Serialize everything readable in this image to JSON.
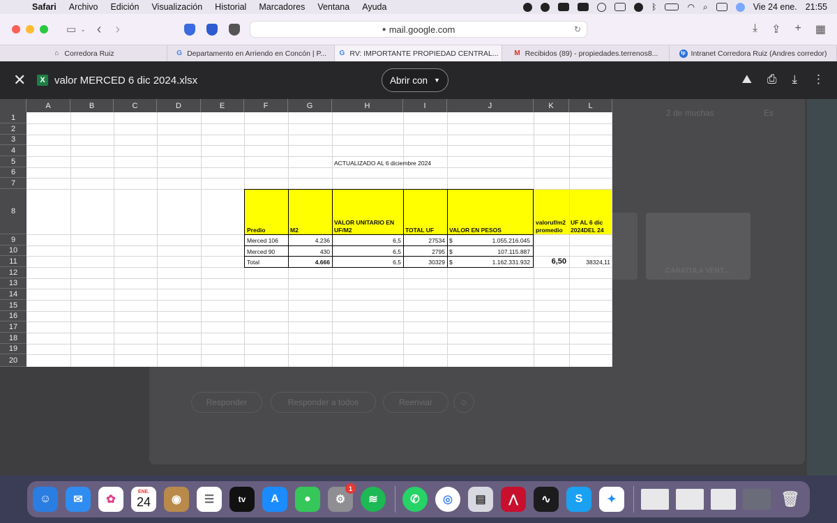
{
  "menubar": {
    "app": "Safari",
    "items": [
      "Archivo",
      "Edición",
      "Visualización",
      "Historial",
      "Marcadores",
      "Ventana",
      "Ayuda"
    ],
    "date": "Vie 24 ene.",
    "time": "21:55"
  },
  "browser": {
    "url": "mail.google.com",
    "tabs": [
      {
        "label": "Corredora Ruiz",
        "icon": "house-icon"
      },
      {
        "label": "Departamento en Arriendo en Concón | P...",
        "icon": "google-icon"
      },
      {
        "label": "RV: IMPORTANTE PROPIEDAD CENTRAL...",
        "icon": "google-icon"
      },
      {
        "label": "Recibidos (89) - propiedades.terrenos8...",
        "icon": "gmail-icon"
      },
      {
        "label": "Intranet Corredora Ruiz (Andres corredor)",
        "icon": "intranet-icon"
      }
    ]
  },
  "viewer": {
    "file_name": "valor MERCED 6 dic 2024.xlsx",
    "open_with": "Abrir con"
  },
  "background": {
    "page_count": "2 de muchas",
    "lang": "Es",
    "reply": "Responder",
    "reply_all": "Responder a todos",
    "forward": "Reenviar",
    "attachment": "CARATULA VENT..."
  },
  "sheet": {
    "columns": [
      "A",
      "B",
      "C",
      "D",
      "E",
      "F",
      "G",
      "H",
      "I",
      "J",
      "K",
      "L"
    ],
    "rows": [
      "1",
      "2",
      "3",
      "4",
      "5",
      "6",
      "7",
      "8",
      "9",
      "10",
      "11",
      "12",
      "13",
      "14",
      "15",
      "16",
      "17",
      "18",
      "19",
      "20"
    ],
    "title": "ACTUALIZADO AL 6 diciembre 2024",
    "headers": {
      "predio": "Predio",
      "m2": "M2",
      "valor_unitario_1": "VALOR UNITARIO EN",
      "valor_unitario_2": "UF/M2",
      "total_uf": "TOTAL UF",
      "valor_pesos": "VALOR EN PESOS",
      "valoruf_1": "valoruf/m2",
      "valoruf_2": "promedio",
      "uf_al_1": "UF AL 6 dic",
      "uf_al_2": "2024DEL 24"
    },
    "data_rows": [
      {
        "predio": "Merced 106",
        "m2": "4.236",
        "unit": "6,5",
        "total_uf": "27534",
        "currency": "$",
        "pesos": "1.055.216.045"
      },
      {
        "predio": "Merced 90",
        "m2": "430",
        "unit": "6,5",
        "total_uf": "2795",
        "currency": "$",
        "pesos": "107.115.887"
      },
      {
        "predio": "Total",
        "m2": "4.666",
        "unit": "6,5",
        "total_uf": "30329",
        "currency": "$",
        "pesos": "1.162.331.932",
        "avg": "6,50",
        "uf": "38324,11"
      }
    ]
  },
  "dock": {
    "calendar_month": "ENE.",
    "calendar_day": "24",
    "settings_badge": "1",
    "tv_label": "tv"
  }
}
